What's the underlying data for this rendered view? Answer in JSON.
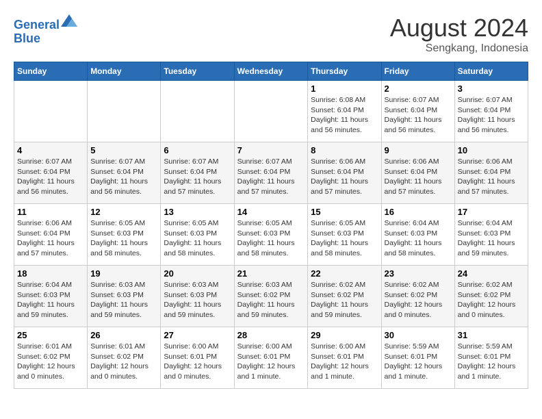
{
  "logo": {
    "line1": "General",
    "line2": "Blue"
  },
  "title": "August 2024",
  "subtitle": "Sengkang, Indonesia",
  "days_of_week": [
    "Sunday",
    "Monday",
    "Tuesday",
    "Wednesday",
    "Thursday",
    "Friday",
    "Saturday"
  ],
  "weeks": [
    [
      {
        "day": "",
        "info": ""
      },
      {
        "day": "",
        "info": ""
      },
      {
        "day": "",
        "info": ""
      },
      {
        "day": "",
        "info": ""
      },
      {
        "day": "1",
        "sunrise": "6:08 AM",
        "sunset": "6:04 PM",
        "daylight": "11 hours and 56 minutes."
      },
      {
        "day": "2",
        "sunrise": "6:07 AM",
        "sunset": "6:04 PM",
        "daylight": "11 hours and 56 minutes."
      },
      {
        "day": "3",
        "sunrise": "6:07 AM",
        "sunset": "6:04 PM",
        "daylight": "11 hours and 56 minutes."
      }
    ],
    [
      {
        "day": "4",
        "sunrise": "6:07 AM",
        "sunset": "6:04 PM",
        "daylight": "11 hours and 56 minutes."
      },
      {
        "day": "5",
        "sunrise": "6:07 AM",
        "sunset": "6:04 PM",
        "daylight": "11 hours and 56 minutes."
      },
      {
        "day": "6",
        "sunrise": "6:07 AM",
        "sunset": "6:04 PM",
        "daylight": "11 hours and 57 minutes."
      },
      {
        "day": "7",
        "sunrise": "6:07 AM",
        "sunset": "6:04 PM",
        "daylight": "11 hours and 57 minutes."
      },
      {
        "day": "8",
        "sunrise": "6:06 AM",
        "sunset": "6:04 PM",
        "daylight": "11 hours and 57 minutes."
      },
      {
        "day": "9",
        "sunrise": "6:06 AM",
        "sunset": "6:04 PM",
        "daylight": "11 hours and 57 minutes."
      },
      {
        "day": "10",
        "sunrise": "6:06 AM",
        "sunset": "6:04 PM",
        "daylight": "11 hours and 57 minutes."
      }
    ],
    [
      {
        "day": "11",
        "sunrise": "6:06 AM",
        "sunset": "6:04 PM",
        "daylight": "11 hours and 57 minutes."
      },
      {
        "day": "12",
        "sunrise": "6:05 AM",
        "sunset": "6:03 PM",
        "daylight": "11 hours and 58 minutes."
      },
      {
        "day": "13",
        "sunrise": "6:05 AM",
        "sunset": "6:03 PM",
        "daylight": "11 hours and 58 minutes."
      },
      {
        "day": "14",
        "sunrise": "6:05 AM",
        "sunset": "6:03 PM",
        "daylight": "11 hours and 58 minutes."
      },
      {
        "day": "15",
        "sunrise": "6:05 AM",
        "sunset": "6:03 PM",
        "daylight": "11 hours and 58 minutes."
      },
      {
        "day": "16",
        "sunrise": "6:04 AM",
        "sunset": "6:03 PM",
        "daylight": "11 hours and 58 minutes."
      },
      {
        "day": "17",
        "sunrise": "6:04 AM",
        "sunset": "6:03 PM",
        "daylight": "11 hours and 59 minutes."
      }
    ],
    [
      {
        "day": "18",
        "sunrise": "6:04 AM",
        "sunset": "6:03 PM",
        "daylight": "11 hours and 59 minutes."
      },
      {
        "day": "19",
        "sunrise": "6:03 AM",
        "sunset": "6:03 PM",
        "daylight": "11 hours and 59 minutes."
      },
      {
        "day": "20",
        "sunrise": "6:03 AM",
        "sunset": "6:03 PM",
        "daylight": "11 hours and 59 minutes."
      },
      {
        "day": "21",
        "sunrise": "6:03 AM",
        "sunset": "6:02 PM",
        "daylight": "11 hours and 59 minutes."
      },
      {
        "day": "22",
        "sunrise": "6:02 AM",
        "sunset": "6:02 PM",
        "daylight": "11 hours and 59 minutes."
      },
      {
        "day": "23",
        "sunrise": "6:02 AM",
        "sunset": "6:02 PM",
        "daylight": "12 hours and 0 minutes."
      },
      {
        "day": "24",
        "sunrise": "6:02 AM",
        "sunset": "6:02 PM",
        "daylight": "12 hours and 0 minutes."
      }
    ],
    [
      {
        "day": "25",
        "sunrise": "6:01 AM",
        "sunset": "6:02 PM",
        "daylight": "12 hours and 0 minutes."
      },
      {
        "day": "26",
        "sunrise": "6:01 AM",
        "sunset": "6:02 PM",
        "daylight": "12 hours and 0 minutes."
      },
      {
        "day": "27",
        "sunrise": "6:00 AM",
        "sunset": "6:01 PM",
        "daylight": "12 hours and 0 minutes."
      },
      {
        "day": "28",
        "sunrise": "6:00 AM",
        "sunset": "6:01 PM",
        "daylight": "12 hours and 1 minute."
      },
      {
        "day": "29",
        "sunrise": "6:00 AM",
        "sunset": "6:01 PM",
        "daylight": "12 hours and 1 minute."
      },
      {
        "day": "30",
        "sunrise": "5:59 AM",
        "sunset": "6:01 PM",
        "daylight": "12 hours and 1 minute."
      },
      {
        "day": "31",
        "sunrise": "5:59 AM",
        "sunset": "6:01 PM",
        "daylight": "12 hours and 1 minute."
      }
    ]
  ],
  "labels": {
    "sunrise": "Sunrise:",
    "sunset": "Sunset:",
    "daylight": "Daylight:"
  }
}
